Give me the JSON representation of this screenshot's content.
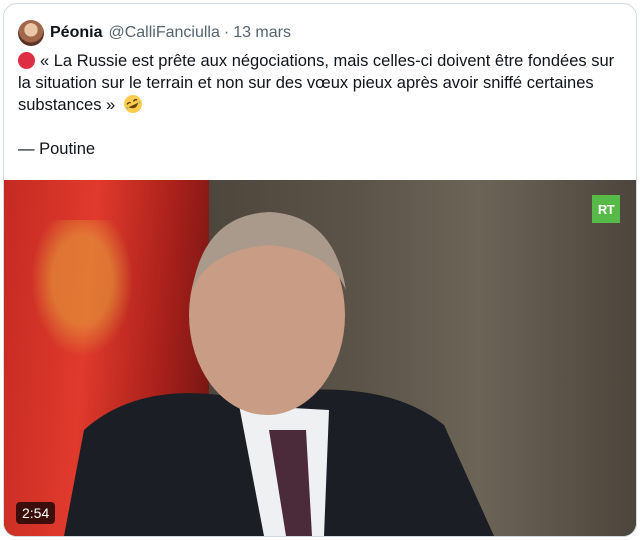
{
  "post": {
    "author_name": "Péonia",
    "handle": "@CalliFanciulla",
    "separator": "·",
    "date": "13 mars",
    "text_body": "« La Russie est prête aux négociations, mais celles-ci doivent être fondées sur la situation sur le terrain et non sur des vœux pieux après avoir sniffé certaines substances »",
    "attribution": "— Poutine"
  },
  "media": {
    "duration": "2:54",
    "logo_text": "RT"
  },
  "colors": {
    "border": "#cfd9de",
    "secondary_text": "#536471",
    "red_circle": "#dd2e44",
    "rt_green": "#57b947"
  },
  "icons": {
    "red_circle": "large-red-circle-emoji",
    "laughing": "rolling-on-floor-laughing-emoji"
  }
}
